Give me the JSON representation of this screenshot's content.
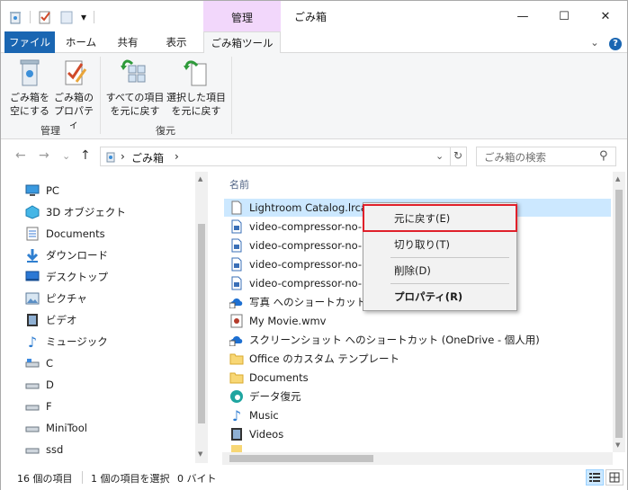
{
  "window": {
    "title": "ごみ箱",
    "context_tab": "管理",
    "controls": {
      "minimize": "—",
      "maximize": "☐",
      "close": "✕"
    }
  },
  "quick_access": {
    "dropdown": "▾"
  },
  "ribbon_tabs": {
    "file": "ファイル",
    "home": "ホーム",
    "share": "共有",
    "view": "表示",
    "recycle_tools": "ごみ箱ツール",
    "expand": "⌄",
    "help": "?"
  },
  "ribbon": {
    "empty_line1": "ごみ箱を",
    "empty_line2": "空にする",
    "props_line1": "ごみ箱の",
    "props_line2": "プロパティ",
    "restore_all_line1": "すべての項目",
    "restore_all_line2": "を元に戻す",
    "restore_sel_line1": "選択した項目",
    "restore_sel_line2": "を元に戻す",
    "group_manage": "管理",
    "group_restore": "復元"
  },
  "address": {
    "back": "←",
    "forward": "→",
    "recent": "⌄",
    "up": "↑",
    "sep1": "›",
    "crumb": "ごみ箱",
    "sep2": "›",
    "dropdown": "⌄",
    "refresh": "↻",
    "search_placeholder": "ごみ箱の検索",
    "search_icon": "⚲"
  },
  "nav_pane": [
    {
      "label": "PC",
      "icon": "pc-icon"
    },
    {
      "label": "3D オブジェクト",
      "icon": "3d-objects-icon"
    },
    {
      "label": "Documents",
      "icon": "documents-icon"
    },
    {
      "label": "ダウンロード",
      "icon": "download-icon"
    },
    {
      "label": "デスクトップ",
      "icon": "desktop-icon"
    },
    {
      "label": "ピクチャ",
      "icon": "pictures-icon"
    },
    {
      "label": "ビデオ",
      "icon": "videos-icon"
    },
    {
      "label": "ミュージック",
      "icon": "music-icon"
    },
    {
      "label": "C",
      "icon": "drive-icon"
    },
    {
      "label": "D",
      "icon": "drive-icon"
    },
    {
      "label": "F",
      "icon": "drive-icon"
    },
    {
      "label": "MiniTool",
      "icon": "drive-icon"
    },
    {
      "label": "ssd",
      "icon": "drive-icon"
    }
  ],
  "file_list": {
    "column_name": "名前",
    "items": [
      {
        "name": "Lightroom Catalog.lrcat",
        "icon": "file-icon",
        "selected": true
      },
      {
        "name": "video-compressor-no-limit",
        "icon": "doc-icon"
      },
      {
        "name": "video-compressor-no-limit",
        "icon": "doc-icon"
      },
      {
        "name": "video-compressor-no-limit",
        "icon": "doc-icon"
      },
      {
        "name": "video-compressor-no-limit",
        "icon": "doc-icon"
      },
      {
        "name": "写真 へのショートカット (OneDrive - 個人用)",
        "icon": "shortcut-icon"
      },
      {
        "name": "My Movie.wmv",
        "icon": "video-file-icon"
      },
      {
        "name": "スクリーンショット へのショートカット (OneDrive - 個人用)",
        "icon": "shortcut-icon"
      },
      {
        "name": "Office のカスタム テンプレート",
        "icon": "folder-icon"
      },
      {
        "name": "Documents",
        "icon": "folder-icon"
      },
      {
        "name": "データ復元",
        "icon": "edge-icon"
      },
      {
        "name": "Music",
        "icon": "music-icon"
      },
      {
        "name": "Videos",
        "icon": "videos-icon"
      }
    ]
  },
  "status": {
    "count": "16 個の項目",
    "selected": "1 個の項目を選択",
    "size": "0 バイト"
  },
  "context_menu": {
    "restore": "元に戻す(E)",
    "cut": "切り取り(T)",
    "delete": "削除(D)",
    "properties": "プロパティ(R)"
  },
  "colors": {
    "file_tab": "#1a66b2",
    "manage_tab": "#f2d7fb",
    "selection": "#cce8ff",
    "highlight": "#e0202a"
  }
}
